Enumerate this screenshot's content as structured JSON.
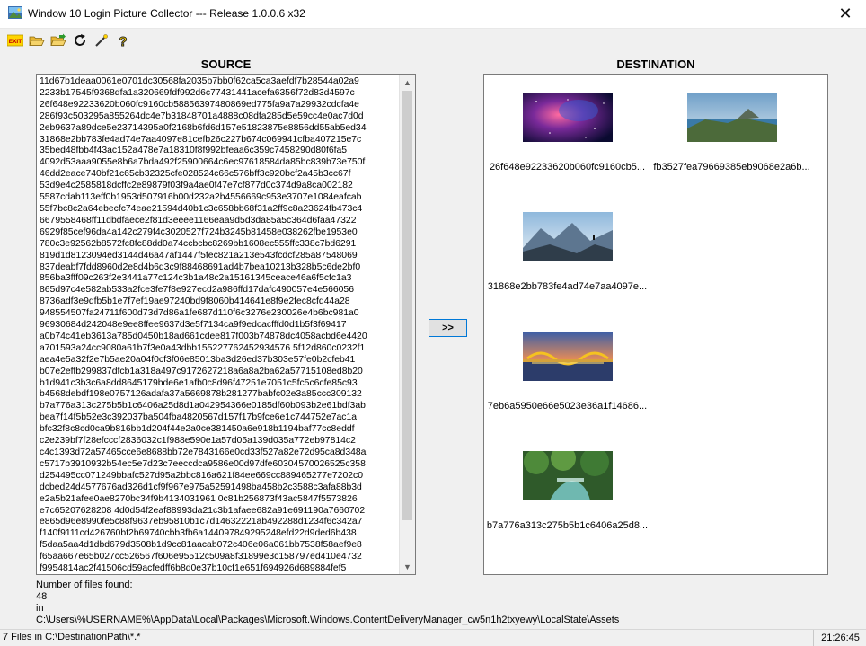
{
  "window": {
    "title": "Window 10 Login Picture Collector --- Release 1.0.0.6 x32"
  },
  "toolbar": {
    "exit_label": "EXIT"
  },
  "source": {
    "heading": "SOURCE",
    "files": [
      "11d67b1deaa0061e0701dc30568fa2035b7bb0f62ca5ca3aefdf7b28544a02a9",
      "2233b17545f9368dfa1a320669fdf992d6c77431441acefa6356f72d83d4597c",
      "26f648e92233620b060fc9160cb58856397480869ed775fa9a7a29932cdcfa4e",
      "286f93c503295a855264dc4e7b31848701a4888c08dfa285d5e59cc4e0ac7d0d",
      "2eb9637a89dce5e23714395a0f2168b6fd6d157e51823875e8856dd55ab5ed34",
      "31868e2bb783fe4ad74e7aa4097e81cefb26c227b674c069941cfba407215e7c",
      "35bed48fbb4f43ac152a478e7a18310f8f992bfeaa6c359c7458290d80f6fa5",
      "4092d53aaa9055e8b6a7bda492f25900664c6ec97618584da85bc839b73e750f",
      "46dd2eace740bf21c65cb32325cfe028524c66c576bff3c920bcf2a45b3cc67f",
      "53d9e4c2585818dcffc2e89879f03f9a4ae0f47e7cf877d0c374d9a8ca002182",
      "5587cdab113eff0b1953d507916b00d232a2b4556669c953e3707e1084eafcab",
      "55f7bc8c2a64ebecfc74eae21594d40b1c3c658bb68f31a2ff9c8a23624fb473c4",
      "6679558468ff11dbdfaece2f81d3eeee1166eaa9d5d3da85a5c364d6faa47322",
      "6929f85cef96da4a142c279f4c3020527f724b3245b81458e038262fbe1953e0",
      "780c3e92562b8572fc8fc88dd0a74ccbcbc8269bb1608ec555ffc338c7bd6291",
      "819d1d8123094ed3144d46a47af1447f5fec821a213e543fcdcf285a87548069",
      "837deabf7fdd8960d2e8d4b6d3c9f88468691ad4b7bea10213b328b5c6de2bf0",
      "856ba3fff09c263f2e3441a77c124c3b1a48c2a15161345ceace46a6f5cfc1a3",
      "865d97c4e582ab533a2fce3fe7f8e927ecd2a986ffd17dafc490057e4e566056",
      "8736adf3e9dfb5b1e7f7ef19ae97240bd9f8060b414641e8f9e2fec8cfd44a28",
      "948554507fa24711f600d73d7d86a1fe687d110f6c3276e230026e4b6bc981a0",
      "96930684d242048e9ee8ffee9637d3e5f7134ca9f9edcacfffd0d1b5f3f69417",
      "a0b74c41eb3613a785d0450b18ad661cdee817f003b74878dc4058acbd6e4420",
      "a701593a24cc9080a61b7f3e0a43dbb155227762452934576 5f12d860c0232f1",
      "aea4e5a32f2e7b5ae20a04f0cf3f06e85013ba3d26ed37b303e57fe0b2cfeb41",
      "b07e2effb299837dfcb1a318a497c9172627218a6a8a2ba62a57715108ed8b20",
      "b1d941c3b3c6a8dd8645179bde6e1afb0c8d96f47251e7051c5fc5c6cfe85c93",
      "b4568debdf198e0757126adafa37a5669878b281277babfc02e3a85ccc309132",
      "b7a776a313c275b5b1c6406a25d8d1a042954366e0185df60b093b2e61bdf3ab",
      "bea7f14f5b52e3c392037ba504fba4820567d157f17b9fce6e1c744752e7ac1a",
      "bfc32f8c8cd0ca9b816bb1d204f44e2a0ce381450a6e918b1194baf77cc8eddf",
      "c2e239bf7f28efcccf2836032c1f988e590e1a57d05a139d035a772eb97814c2",
      "c4c1393d72a57465cce6e8688bb72e7843166e0cd33f527a82e72d95ca8d348a",
      "c5717b3910932b54ec5e7d23c7eeccdca9586e00d97dfe60304570026525c358",
      "d254495cc071249bbafc527d95a2bbc816a621f84ee669cc889465277e7202c0",
      "dcbed24d4577676ad326d1cf9f967e975a52591498ba458b2c3588c3afa88b3d",
      "e2a5b21afee0ae8270bc34f9b4134031961 0c81b256873f43ac5847f5573826",
      "e7c65207628208 4d0d54f2eaf88993da21c3b1afaee682a91e691190a7660702",
      "e865d96e8990fe5c88f9637eb95810b1c7d14632221ab492288d1234f6c342a7",
      "f140f9111cd426760bf2b69740cbb3fb6a144097849295248efd22d9ded6b438",
      "f5daa5aa4d1dbd679d3508b1d9cc81aacab072c406e06a061bb7538f58aef9e8",
      "f65aa667e65b027cc526567f606e95512c509a8f31899e3c158797ed410e4732",
      "f9954814ac2f41506cd59acfedff6b8d0e37b10cf1e651f694926d689884fef5"
    ]
  },
  "transfer_button": ">>",
  "destination": {
    "heading": "DESTINATION",
    "items": [
      {
        "caption": "26f648e92233620b060fc9160cb5...",
        "image": "galaxy-nebula"
      },
      {
        "caption": "fb3527fea79669385eb9068e2a6b...",
        "image": "coastal-landscape"
      },
      {
        "caption": "31868e2bb783fe4ad74e7aa4097e...",
        "image": "mountains"
      },
      {
        "caption": "7eb6a5950e66e5023e36a1f14686...",
        "image": "dragon-bridge"
      },
      {
        "caption": "b7a776a313c275b5b1c6406a25d8...",
        "image": "forest-stream"
      }
    ]
  },
  "info": {
    "label": "Number of files found:",
    "count": "48",
    "in_label": "in",
    "path": "C:\\Users\\%USERNAME%\\AppData\\Local\\Packages\\Microsoft.Windows.ContentDeliveryManager_cw5n1h2txyewy\\LocalState\\Assets"
  },
  "status": {
    "left": "7 Files in C:\\DestinationPath\\*.*",
    "time": "21:26:45"
  }
}
